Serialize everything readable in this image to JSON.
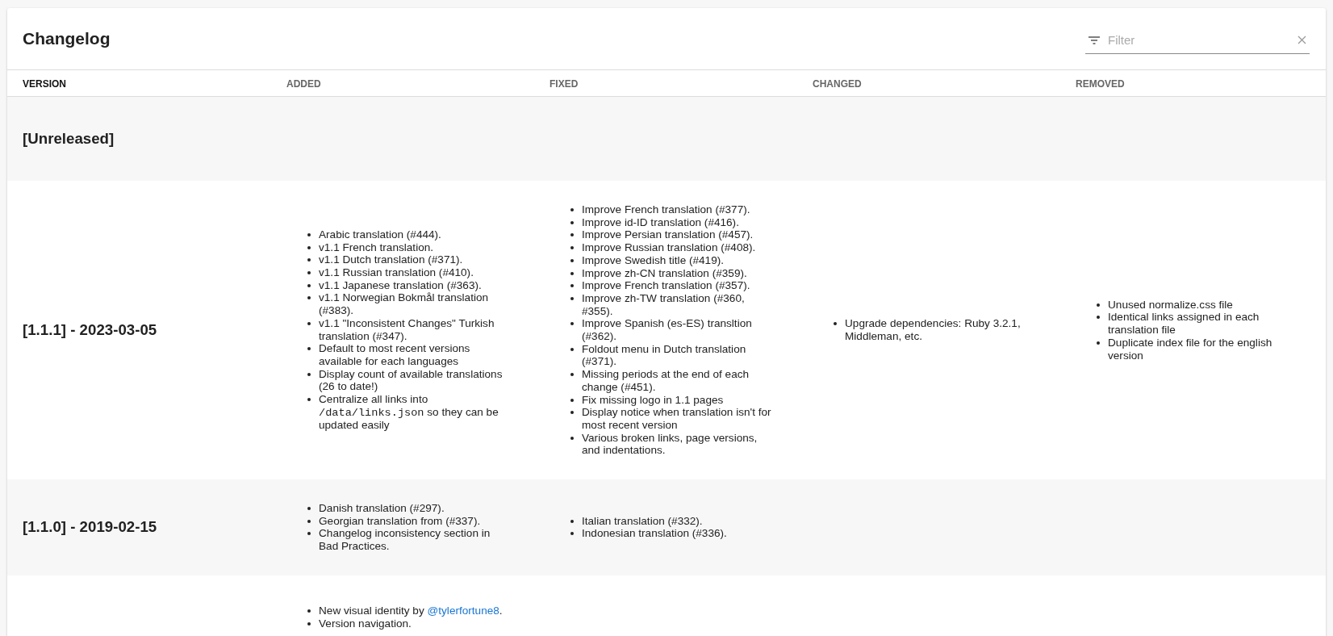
{
  "title": "Changelog",
  "filter": {
    "placeholder": "Filter"
  },
  "columns": [
    {
      "label": "VERSION",
      "selected": true
    },
    {
      "label": "ADDED",
      "selected": false
    },
    {
      "label": "FIXED",
      "selected": false
    },
    {
      "label": "CHANGED",
      "selected": false
    },
    {
      "label": "REMOVED",
      "selected": false
    }
  ],
  "rows": [
    {
      "version": "[Unreleased]",
      "added": [],
      "fixed": [],
      "changed": [],
      "removed": []
    },
    {
      "version": "[1.1.1] - 2023-03-05",
      "added": [
        "Arabic translation (#444).",
        "v1.1 French translation.",
        "v1.1 Dutch translation (#371).",
        "v1.1 Russian translation (#410).",
        "v1.1 Japanese translation (#363).",
        "v1.1 Norwegian Bokmål translation (#383).",
        "v1.1 \"Inconsistent Changes\" Turkish translation (#347).",
        "Default to most recent versions available for each languages",
        "Display count of available translations (26 to date!)",
        [
          {
            "kind": "text",
            "text": "Centralize all links into "
          },
          {
            "kind": "code",
            "text": "/data/links.json"
          },
          {
            "kind": "text",
            "text": " so they can be updated easily"
          }
        ]
      ],
      "fixed": [
        "Improve French translation (#377).",
        "Improve id-ID translation (#416).",
        "Improve Persian translation (#457).",
        "Improve Russian translation (#408).",
        "Improve Swedish title (#419).",
        "Improve zh-CN translation (#359).",
        "Improve French translation (#357).",
        "Improve zh-TW translation (#360, #355).",
        "Improve Spanish (es-ES) transltion (#362).",
        "Foldout menu in Dutch translation (#371).",
        "Missing periods at the end of each change (#451).",
        "Fix missing logo in 1.1 pages",
        "Display notice when translation isn't for most recent version",
        "Various broken links, page versions, and indentations."
      ],
      "changed": [
        "Upgrade dependencies: Ruby 3.2.1, Middleman, etc."
      ],
      "removed": [
        "Unused normalize.css file",
        "Identical links assigned in each translation file",
        "Duplicate index file for the english version"
      ]
    },
    {
      "version": "[1.1.0] - 2019-02-15",
      "added": [
        "Danish translation (#297).",
        "Georgian translation from (#337).",
        "Changelog inconsistency section in Bad Practices."
      ],
      "fixed": [
        "Italian translation (#332).",
        "Indonesian translation (#336)."
      ],
      "changed": [],
      "removed": []
    },
    {
      "added": [
        [
          {
            "kind": "text",
            "text": "New visual identity by "
          },
          {
            "kind": "link",
            "text": "@tylerfortune8"
          },
          {
            "kind": "text",
            "text": "."
          }
        ],
        "Version navigation."
      ],
      "fixed": [],
      "changed": [],
      "removed": []
    }
  ]
}
